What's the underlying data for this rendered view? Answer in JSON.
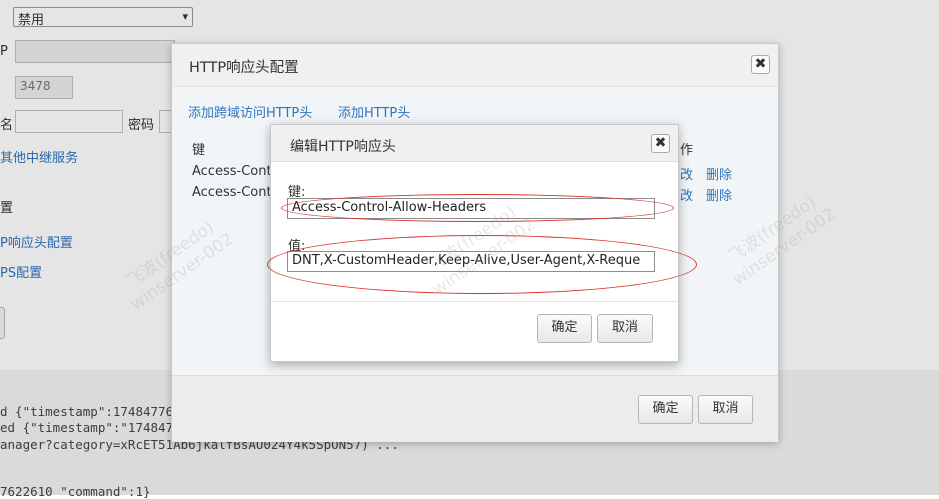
{
  "background": {
    "select_value": "禁用",
    "ip_label": "P",
    "port_value": "3478",
    "username_label": "名",
    "password_label": "密码",
    "relay_link": "其他中继服务",
    "section_fragment": "置",
    "http_header_link": "P响应头配置",
    "https_link": "PS配置",
    "log_lines": [
      "d {\"timestamp\":174847763",
      "ed {\"timestamp\":\"174847",
      "anager?category=xRcET51Ab6jkalfBsAU024Y4k5SpON57) ...",
      "7622610 \"command\":1}"
    ]
  },
  "outer_modal": {
    "title": "HTTP响应头配置",
    "close_label": "✖",
    "add_cors_link": "添加跨域访问HTTP头",
    "add_header_link": "添加HTTP头",
    "table": {
      "col_key": "键",
      "col_action": "作",
      "rows": [
        {
          "key": "Access-Cont",
          "edit": "改",
          "delete": "删除"
        },
        {
          "key": "Access-Cont",
          "edit": "改",
          "delete": "删除"
        }
      ]
    },
    "ok_label": "确定",
    "cancel_label": "取消"
  },
  "inner_modal": {
    "title": "编辑HTTP响应头",
    "close_label": "✖",
    "key_label": "键:",
    "key_value": "Access-Control-Allow-Headers",
    "value_label": "值:",
    "value_value": "DNT,X-CustomHeader,Keep-Alive,User-Agent,X-Reque",
    "ok_label": "确定",
    "cancel_label": "取消"
  },
  "annotation_color": "#d9352c",
  "watermarks": [
    "飞波(freedo)",
    "winserver-002"
  ]
}
